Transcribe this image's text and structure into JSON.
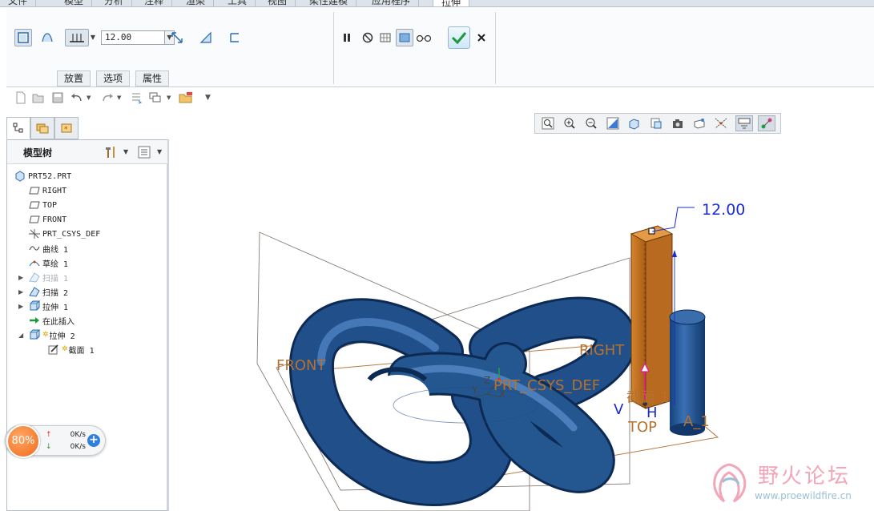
{
  "ribbon_tabs": [
    "文件",
    "模型",
    "分析",
    "注释",
    "渲染",
    "工具",
    "视图",
    "柔性建模",
    "应用程序",
    "拉伸"
  ],
  "ribbon": {
    "depth_value": "12.00",
    "subtabs": [
      "放置",
      "选项",
      "属性"
    ]
  },
  "model_tree": {
    "title": "模型树",
    "items": [
      {
        "label": "PRT52.PRT",
        "icon": "part-icon",
        "depth": 0,
        "expand": false,
        "dim": false
      },
      {
        "label": "RIGHT",
        "icon": "datum-plane-icon",
        "depth": 1,
        "expand": false,
        "dim": false
      },
      {
        "label": "TOP",
        "icon": "datum-plane-icon",
        "depth": 1,
        "expand": false,
        "dim": false
      },
      {
        "label": "FRONT",
        "icon": "datum-plane-icon",
        "depth": 1,
        "expand": false,
        "dim": false
      },
      {
        "label": "PRT_CSYS_DEF",
        "icon": "csys-icon",
        "depth": 1,
        "expand": false,
        "dim": false
      },
      {
        "label": "曲线 1",
        "icon": "curve-icon",
        "depth": 1,
        "expand": false,
        "dim": false
      },
      {
        "label": "草绘 1",
        "icon": "sketch-icon",
        "depth": 1,
        "expand": false,
        "dim": false
      },
      {
        "label": "扫描 1",
        "icon": "sweep-icon",
        "depth": 1,
        "expand": true,
        "dim": true
      },
      {
        "label": "扫描 2",
        "icon": "sweep-icon",
        "depth": 1,
        "expand": true,
        "dim": false
      },
      {
        "label": "拉伸 1",
        "icon": "extrude-icon",
        "depth": 1,
        "expand": true,
        "dim": false
      },
      {
        "label": "在此插入",
        "icon": "insert-here-icon",
        "depth": 1,
        "expand": false,
        "dim": false
      },
      {
        "label": "拉伸 2",
        "icon": "extrude-active-icon",
        "depth": 1,
        "expand": true,
        "expanded": true,
        "dim": false
      },
      {
        "label": "截面 1",
        "icon": "section-icon",
        "depth": 2,
        "expand": false,
        "dim": false
      }
    ]
  },
  "graphics": {
    "dimension_label": "12.00",
    "datum_labels": [
      "FRONT",
      "RIGHT",
      "TOP",
      "PRT_CSYS_DEF",
      "截面 1",
      "A_1"
    ],
    "axis_letters": [
      "V",
      "H",
      "Z",
      "Y",
      "X"
    ],
    "model_color": "#1d4f8c",
    "extrude_color": "#c8731f"
  },
  "net_meter": {
    "percent": "80%",
    "up": "0K/s",
    "down": "0K/s"
  },
  "watermark": {
    "title": "野火论坛",
    "url": "www.proewildfire.cn"
  }
}
